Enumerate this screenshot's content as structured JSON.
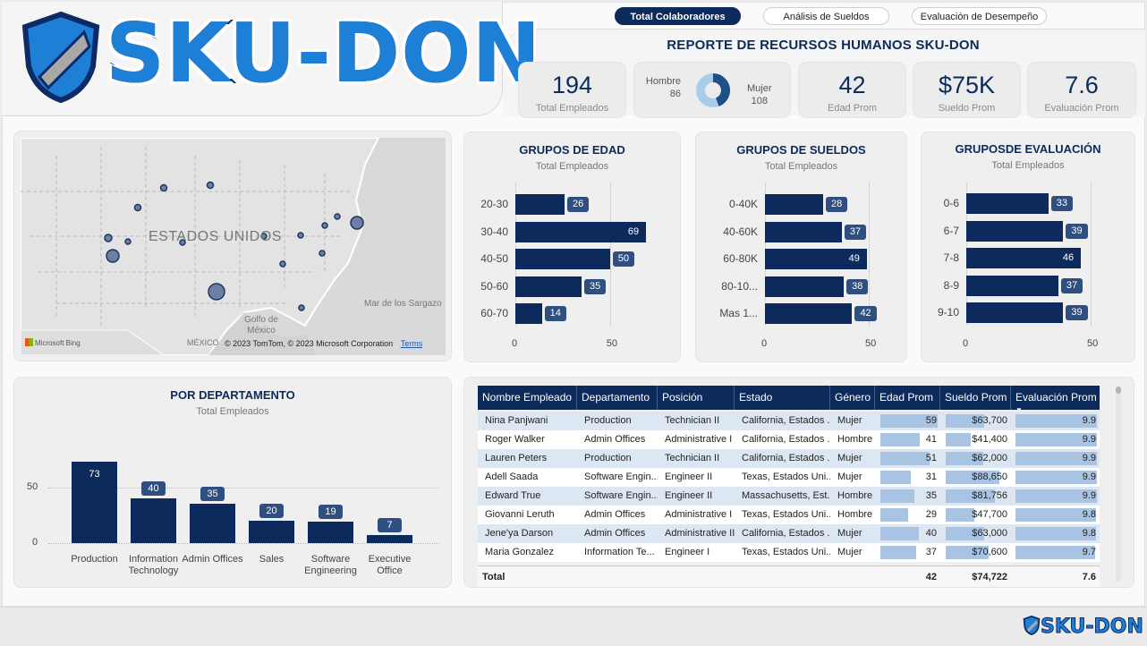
{
  "brand": {
    "logo_text": "SKU-DON",
    "accent": "#0d2a5c",
    "logo_blue": "#1e7fd6"
  },
  "tabs": [
    {
      "label": "Total Colaboradores",
      "active": true
    },
    {
      "label": "Análisis de Sueldos",
      "active": false
    },
    {
      "label": "Evaluación de Desempeño",
      "active": false
    }
  ],
  "report_title": "REPORTE DE RECURSOS HUMANOS SKU-DON",
  "kpis": {
    "total": {
      "value": "194",
      "label": "Total Empleados"
    },
    "gender": {
      "male_label": "Hombre",
      "male_value": "86",
      "female_label": "Mujer",
      "female_value": "108"
    },
    "age": {
      "value": "42",
      "label": "Edad Prom"
    },
    "salary": {
      "value": "$75K",
      "label": "Sueldo Prom"
    },
    "eval": {
      "value": "7.6",
      "label": "Evaluación Prom"
    }
  },
  "map": {
    "country_label": "ESTADOS UNIDOS",
    "gulf_label": "Golfo de México",
    "sea_label": "Mar de los Sargazo",
    "mexico_label": "MÉXICO",
    "bing_label": "Microsoft Bing",
    "copyright": "© 2023 TomTom, © 2023 Microsoft Corporation",
    "terms": "Terms"
  },
  "age_chart": {
    "title": "GRUPOS DE EDAD",
    "subtitle": "Total Empleados",
    "chart_data": {
      "type": "bar",
      "orientation": "horizontal",
      "categories": [
        "20-30",
        "30-40",
        "40-50",
        "50-60",
        "60-70"
      ],
      "values": [
        26,
        69,
        50,
        35,
        14
      ],
      "xlim": [
        0,
        70
      ],
      "ticks": [
        "0",
        "50"
      ]
    }
  },
  "salary_chart": {
    "title": "GRUPOS DE SUELDOS",
    "subtitle": "Total Empleados",
    "chart_data": {
      "type": "bar",
      "orientation": "horizontal",
      "categories": [
        "0-40K",
        "40-60K",
        "60-80K",
        "80-10...",
        "Mas 1..."
      ],
      "values": [
        28,
        37,
        49,
        38,
        42
      ],
      "xlim": [
        0,
        50
      ],
      "ticks": [
        "0",
        "50"
      ]
    }
  },
  "eval_chart": {
    "title": "GRUPOSDE EVALUACIÓN",
    "subtitle": "Total Empleados",
    "chart_data": {
      "type": "bar",
      "orientation": "horizontal",
      "categories": [
        "0-6",
        "6-7",
        "7-8",
        "8-9",
        "9-10"
      ],
      "values": [
        33,
        39,
        46,
        37,
        39
      ],
      "xlim": [
        0,
        50
      ],
      "ticks": [
        "0",
        "50"
      ]
    }
  },
  "dept_chart": {
    "title": "POR DEPARTAMENTO",
    "subtitle": "Total Empleados",
    "chart_data": {
      "type": "bar",
      "orientation": "vertical",
      "categories": [
        "Production",
        "Information Technology",
        "Admin Offices",
        "Sales",
        "Software Engineering",
        "Executive Office"
      ],
      "values": [
        73,
        40,
        35,
        20,
        19,
        7
      ],
      "ylim": [
        0,
        80
      ],
      "ticks": [
        "0",
        "50"
      ]
    }
  },
  "table": {
    "columns": [
      "Nombre Empleado",
      "Departamento",
      "Posición",
      "Estado",
      "Género",
      "Edad Prom",
      "Sueldo Prom",
      "Evaluación Prom"
    ],
    "rows": [
      {
        "name": "Nina Panjwani",
        "dept": "Production",
        "pos": "Technician II",
        "state": "California, Estados ...",
        "gender": "Mujer",
        "age": 59,
        "salary": "$63,700",
        "salary_val": 63700,
        "eval": "9.9"
      },
      {
        "name": "Roger Walker",
        "dept": "Admin Offices",
        "pos": "Administrative I",
        "state": "California, Estados ...",
        "gender": "Hombre",
        "age": 41,
        "salary": "$41,400",
        "salary_val": 41400,
        "eval": "9.9"
      },
      {
        "name": "Lauren Peters",
        "dept": "Production",
        "pos": "Technician II",
        "state": "California, Estados ...",
        "gender": "Mujer",
        "age": 51,
        "salary": "$62,000",
        "salary_val": 62000,
        "eval": "9.9"
      },
      {
        "name": "Adell Saada",
        "dept": "Software Engin...",
        "pos": "Engineer II",
        "state": "Texas, Estados Uni...",
        "gender": "Mujer",
        "age": 31,
        "salary": "$88,650",
        "salary_val": 88650,
        "eval": "9.9"
      },
      {
        "name": "Edward True",
        "dept": "Software Engin...",
        "pos": "Engineer II",
        "state": "Massachusetts, Est...",
        "gender": "Hombre",
        "age": 35,
        "salary": "$81,756",
        "salary_val": 81756,
        "eval": "9.9"
      },
      {
        "name": "Giovanni Leruth",
        "dept": "Admin Offices",
        "pos": "Administrative I",
        "state": "Texas, Estados Uni...",
        "gender": "Hombre",
        "age": 29,
        "salary": "$47,700",
        "salary_val": 47700,
        "eval": "9.8"
      },
      {
        "name": "Jene'ya Darson",
        "dept": "Admin Offices",
        "pos": "Administrative II",
        "state": "California, Estados ...",
        "gender": "Mujer",
        "age": 40,
        "salary": "$63,000",
        "salary_val": 63000,
        "eval": "9.8"
      },
      {
        "name": "Maria Gonzalez",
        "dept": "Information Te...",
        "pos": "Engineer I",
        "state": "Texas, Estados Uni...",
        "gender": "Mujer",
        "age": 37,
        "salary": "$70,600",
        "salary_val": 70600,
        "eval": "9.7"
      }
    ],
    "total": {
      "label": "Total",
      "age": "42",
      "salary": "$74,722",
      "eval": "7.6"
    }
  }
}
